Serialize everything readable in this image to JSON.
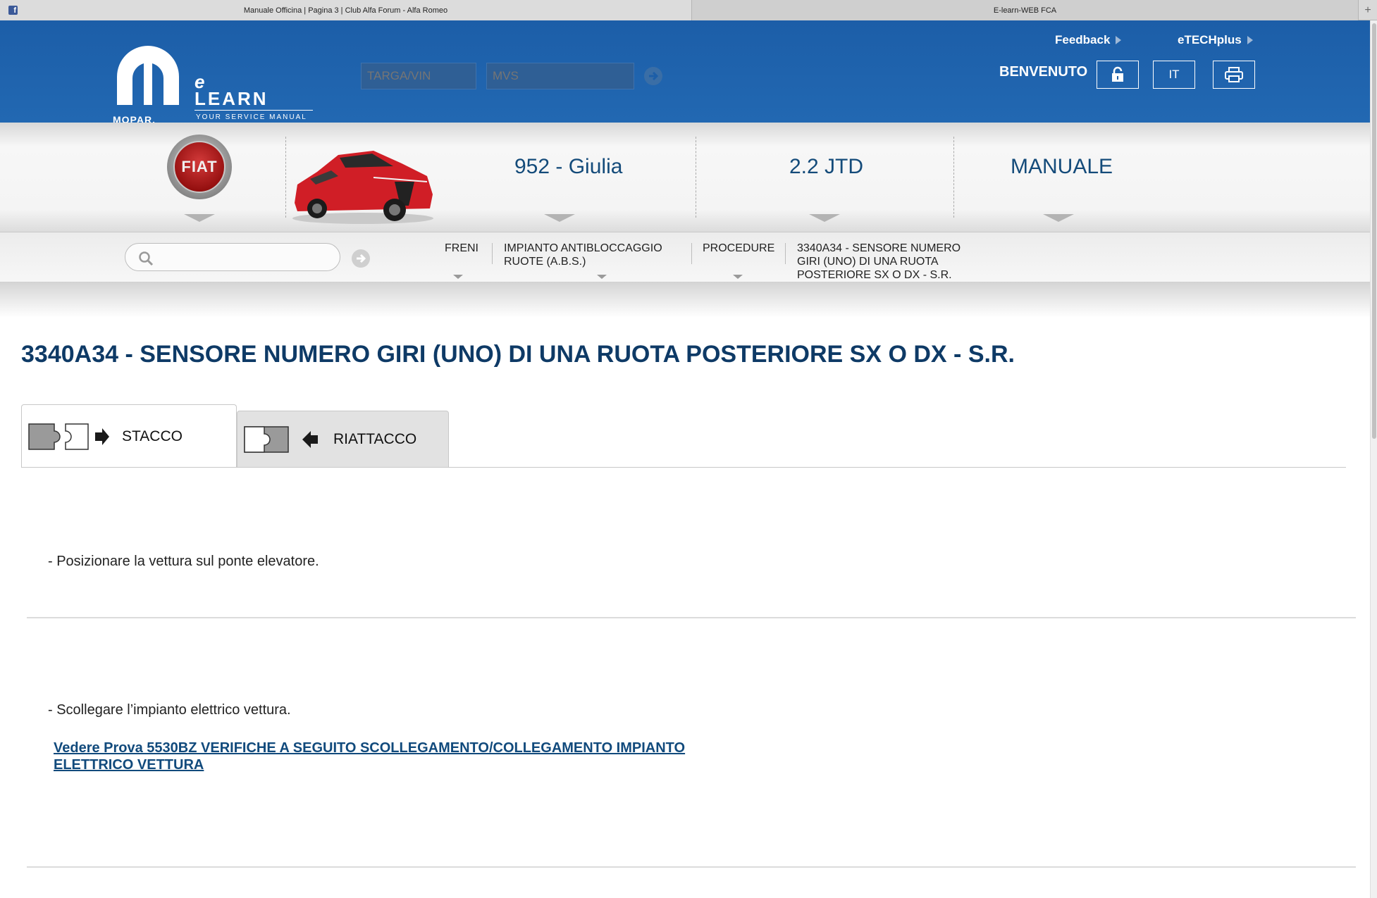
{
  "browser": {
    "tab1_title": "Manuale Officina | Pagina 3 | Club Alfa Forum - Alfa Romeo",
    "tab2_title": "E-learn-WEB FCA",
    "new_tab": "+",
    "favicon_letter": "f"
  },
  "header": {
    "brand_e": "e",
    "brand_learn": "LEARN",
    "brand_sub": "YOUR SERVICE MANUAL",
    "brand_mopar": "MOPAR.",
    "targa_placeholder": "TARGA/VIN",
    "mvs_placeholder": "MVS",
    "feedback_label": "Feedback",
    "etech_label": "eTECHplus",
    "welcome": "BENVENUTO",
    "lang": "IT"
  },
  "vehicle": {
    "brand_badge": "FIAT",
    "model": "952 - Giulia",
    "engine": "2.2 JTD",
    "document": "MANUALE"
  },
  "breadcrumb": {
    "items": [
      "FRENI",
      "IMPIANTO ANTIBLOCCAGGIO RUOTE (A.B.S.)",
      "PROCEDURE",
      "3340A34 - SENSORE NUMERO GIRI (UNO) DI UNA RUOTA POSTERIORE SX O DX - S.R."
    ]
  },
  "content": {
    "title": "3340A34 - SENSORE NUMERO GIRI (UNO) DI UNA RUOTA POSTERIORE SX O DX - S.R.",
    "tabs": [
      "STACCO",
      "RIATTACCO"
    ],
    "steps": [
      "- Posizionare la vettura sul ponte elevatore.",
      "- Scollegare l’impianto elettrico vettura."
    ],
    "link": "Vedere Prova 5530BZ VERIFICHE A SEGUITO SCOLLEGAMENTO/COLLEGAMENTO IMPIANTO ELETTRICO VETTURA"
  },
  "colors": {
    "header_blue": "#1c5ea8",
    "title_blue": "#0e3a66",
    "link_blue": "#114a7c"
  }
}
